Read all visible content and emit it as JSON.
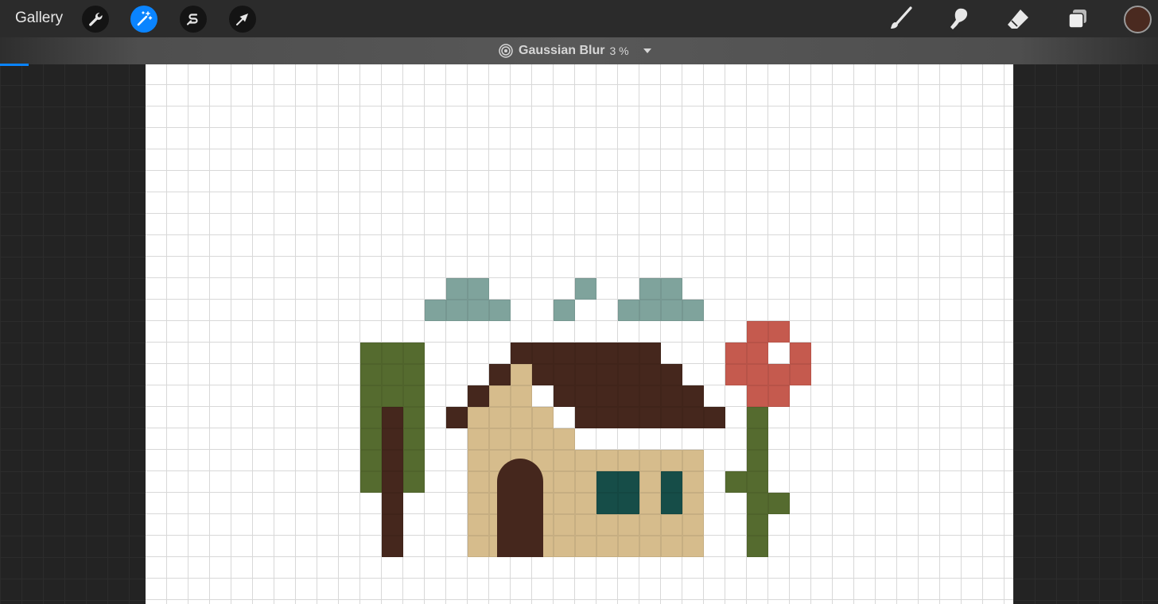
{
  "toolbar": {
    "gallery_label": "Gallery",
    "left_tools": [
      {
        "icon": "wrench-icon",
        "active": false
      },
      {
        "icon": "magic-wand-icon",
        "active": true
      },
      {
        "icon": "selection-s-icon",
        "active": false
      },
      {
        "icon": "arrow-cursor-icon",
        "active": false
      }
    ],
    "right_tools": [
      "brush-icon",
      "smudge-icon",
      "eraser-icon",
      "layers-icon"
    ],
    "current_color": "#4a2a20"
  },
  "adjustment": {
    "icon": "target-rings-icon",
    "name": "Gaussian Blur",
    "value": "3 %",
    "progress": 0.025
  },
  "colors": {
    "accent": "#0a84ff",
    "roof": "#45271d",
    "wall": "#d6bc8c",
    "window": "#164d48",
    "leaf": "#556b2f",
    "trunk": "#45271d",
    "flower": "#c55a4e",
    "cloud": "#7fa39c"
  }
}
